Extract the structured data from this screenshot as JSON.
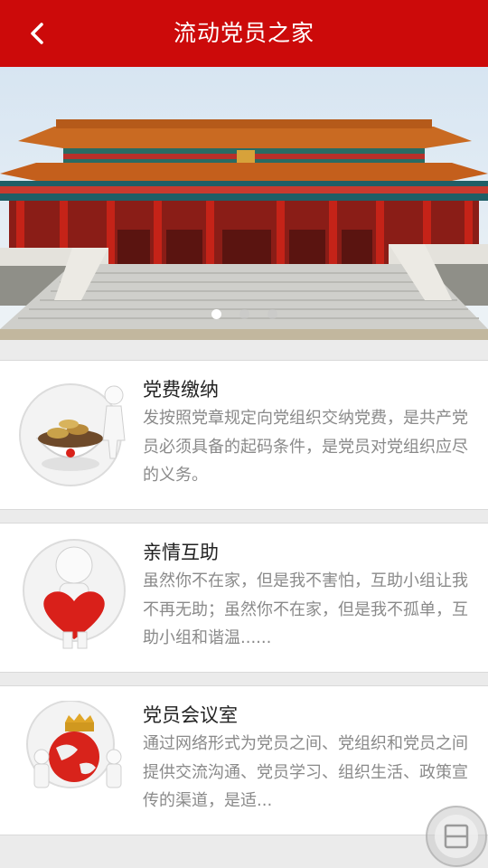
{
  "header": {
    "title": "流动党员之家",
    "back_icon": "chevron-left-icon",
    "background_color": "#cc0a0a"
  },
  "banner": {
    "slide_count": 3,
    "active_slide": 1
  },
  "cards": [
    {
      "title": "党费缴纳",
      "description": "发按照党章规定向党组织交纳党费，是共产党员必须具备的起码条件，是党员对党组织应尽的义务。",
      "icon": "coin-bowl-icon"
    },
    {
      "title": "亲情互助",
      "description": "虽然你不在家，但是我不害怕，互助小组让我不再无助；虽然你不在家，但是我不孤单，互助小组和谐温......",
      "icon": "heart-figure-icon"
    },
    {
      "title": "党员会议室",
      "description": "通过网络形式为党员之间、党组织和党员之间提供交流沟通、党员学习、组织生活、政策宣传的渠道，是适...",
      "icon": "globe-meeting-icon"
    }
  ],
  "floating_button": {
    "icon": "layout-icon"
  }
}
